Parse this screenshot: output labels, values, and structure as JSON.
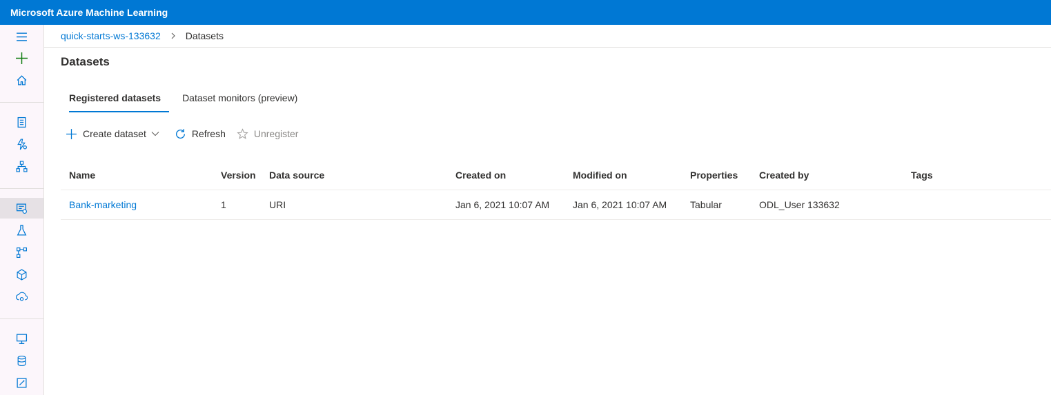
{
  "app": {
    "title": "Microsoft Azure Machine Learning"
  },
  "breadcrumb": {
    "workspace": "quick-starts-ws-133632",
    "current": "Datasets"
  },
  "page": {
    "title": "Datasets"
  },
  "tabs": [
    {
      "label": "Registered datasets",
      "active": true
    },
    {
      "label": "Dataset monitors (preview)",
      "active": false
    }
  ],
  "toolbar": {
    "create_label": "Create dataset",
    "refresh_label": "Refresh",
    "unregister_label": "Unregister"
  },
  "table": {
    "columns": [
      "Name",
      "Version",
      "Data source",
      "Created on",
      "Modified on",
      "Properties",
      "Created by",
      "Tags"
    ],
    "rows": [
      {
        "name": "Bank-marketing",
        "version": "1",
        "data_source": "URI",
        "created_on": "Jan 6, 2021 10:07 AM",
        "modified_on": "Jan 6, 2021 10:07 AM",
        "properties": "Tabular",
        "created_by": "ODL_User 133632",
        "tags": ""
      }
    ]
  },
  "sidebar": {
    "items": [
      "menu-icon",
      "add-icon",
      "home-icon",
      "notebook-icon",
      "automl-icon",
      "designer-icon",
      "datasets-icon",
      "experiments-icon",
      "pipelines-icon",
      "models-icon",
      "endpoints-icon",
      "compute-icon",
      "datastores-icon",
      "data-labeling-icon"
    ]
  },
  "colors": {
    "accent": "#0078d4",
    "add_green": "#107c10",
    "sidebar_bg": "#fcf6fb"
  }
}
